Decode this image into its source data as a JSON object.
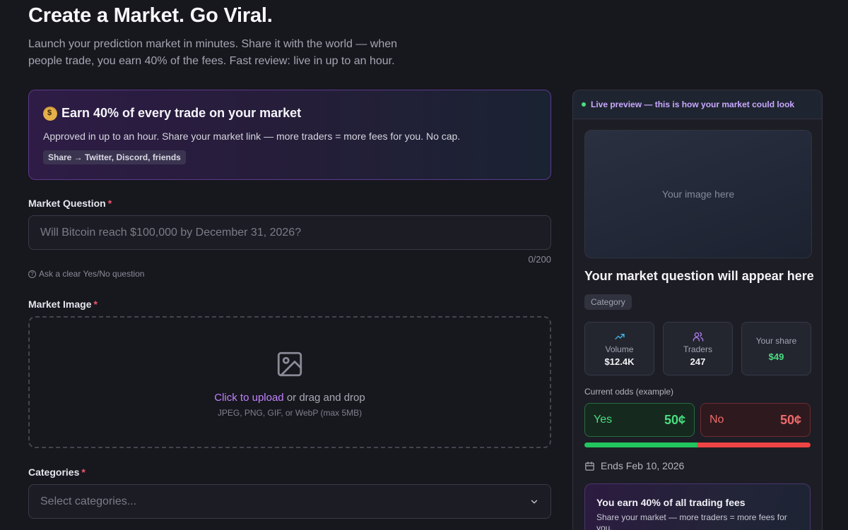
{
  "header": {
    "title": "Create a Market. Go Viral.",
    "subtitle": "Launch your prediction market in minutes. Share it with the world — when people trade, you earn 40% of the fees. Fast review: live in up to an hour."
  },
  "promo": {
    "icon": "money-bag-icon",
    "title": "Earn 40% of every trade on your market",
    "description": "Approved in up to an hour. Share your market link — more traders = more fees for you. No cap.",
    "tag": "Share → Twitter, Discord, friends"
  },
  "form": {
    "question": {
      "label": "Market Question",
      "required": "*",
      "placeholder": "Will Bitcoin reach $100,000 by December 31, 2026?",
      "counter": "0/200",
      "hint": "Ask a clear Yes/No question"
    },
    "image": {
      "label": "Market Image",
      "required": "*",
      "upload_link": "Click to upload",
      "upload_text": " or drag and drop",
      "formats": "JPEG, PNG, GIF, or WebP (max 5MB)"
    },
    "categories": {
      "label": "Categories",
      "required": "*",
      "placeholder": "Select categories..."
    }
  },
  "preview": {
    "header": "Live preview — this is how your market could look",
    "image_placeholder": "Your image here",
    "question": "Your market question will appear here",
    "category": "Category",
    "stats": [
      {
        "label": "Volume",
        "value": "$12.4K",
        "icon": "trending-up-icon"
      },
      {
        "label": "Traders",
        "value": "247",
        "icon": "users-icon"
      },
      {
        "label": "Your share",
        "value": "$49"
      }
    ],
    "odds_label": "Current odds (example)",
    "yes": {
      "label": "Yes",
      "price": "50¢",
      "fraction": 0.5
    },
    "no": {
      "label": "No",
      "price": "50¢"
    },
    "ends": "Ends Feb 10, 2026",
    "earn": {
      "title": "You earn 40% of all trading fees",
      "subtitle": "Share your market — more traders = more fees for you."
    }
  },
  "colors": {
    "accent": "#c084fc",
    "yes": "#4ade80",
    "no": "#f06a6a",
    "required": "#f0566b"
  }
}
